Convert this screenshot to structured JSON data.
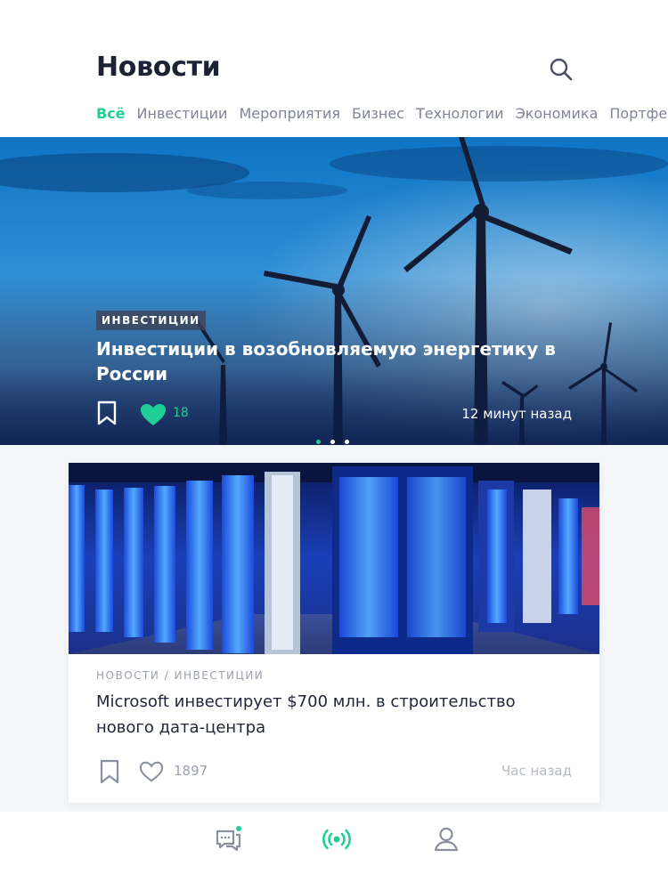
{
  "header": {
    "title": "Новости",
    "search_icon": "search-icon"
  },
  "tabs": [
    {
      "label": "Всё",
      "active": true
    },
    {
      "label": "Инвестиции",
      "active": false
    },
    {
      "label": "Мероприятия",
      "active": false
    },
    {
      "label": "Бизнес",
      "active": false
    },
    {
      "label": "Технологии",
      "active": false
    },
    {
      "label": "Экономика",
      "active": false
    },
    {
      "label": "Портфель",
      "active": false
    }
  ],
  "hero": {
    "category": "ИНВЕСТИЦИИ",
    "title": "Инвестиции в возобновляемую энергетику в России",
    "likes": "18",
    "liked": true,
    "time": "12 минут назад",
    "slides": 3,
    "active_slide": 0
  },
  "article": {
    "category": "НОВОСТИ / ИНВЕСТИЦИИ",
    "title": "Microsoft инвестирует $700 млн. в строительство нового дата-центра",
    "likes": "1897",
    "liked": false,
    "time": "Час назад"
  },
  "bottom_nav": [
    {
      "icon": "chat-icon",
      "has_notification": true,
      "active": false
    },
    {
      "icon": "broadcast-icon",
      "active": true
    },
    {
      "icon": "profile-icon",
      "active": false
    }
  ],
  "colors": {
    "accent": "#1fcf96",
    "title": "#1e2235",
    "muted": "#808596"
  }
}
